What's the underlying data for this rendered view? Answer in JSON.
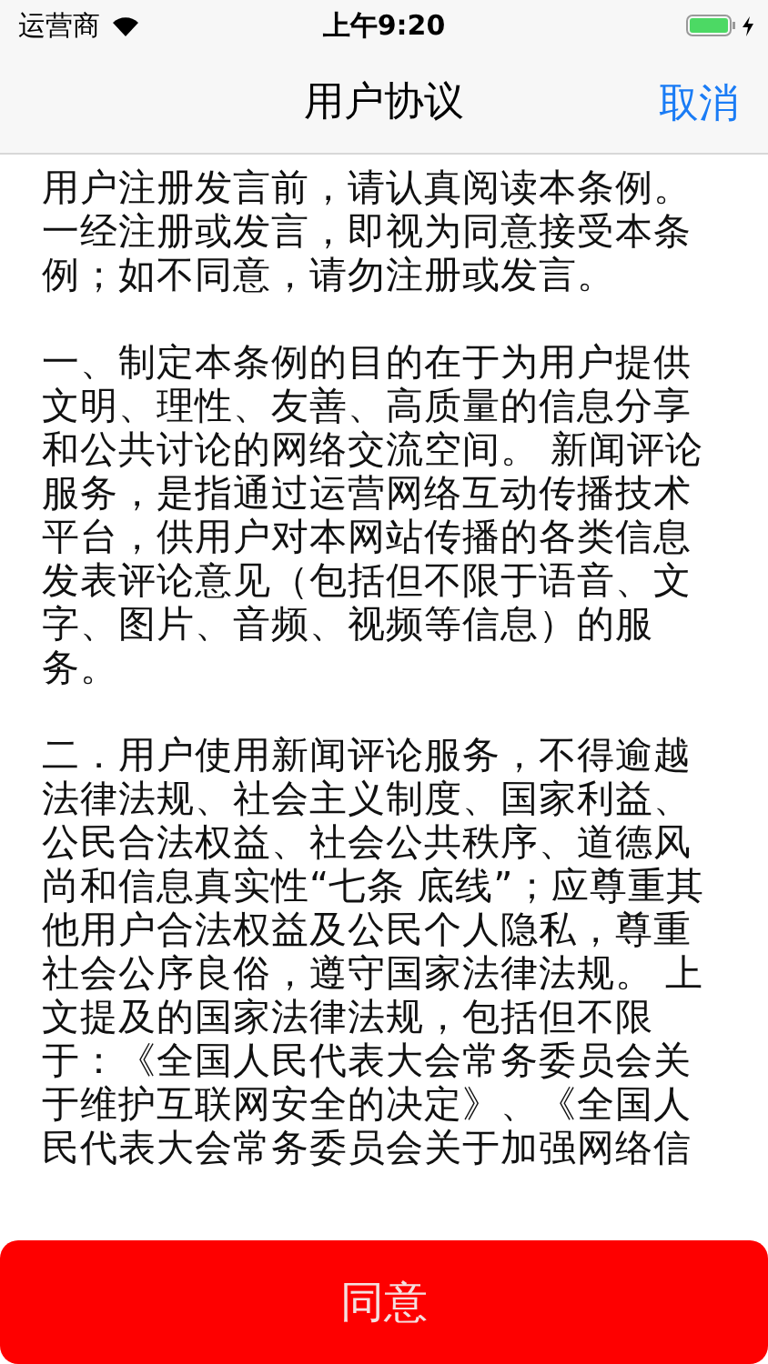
{
  "status_bar": {
    "carrier": "运营商",
    "time": "上午9:20",
    "charging": true
  },
  "nav_bar": {
    "title": "用户协议",
    "cancel": "取消"
  },
  "agreement": {
    "paragraphs": [
      {
        "lines": [
          "用户注册发言前，请认真阅读本条例。",
          "一经注册或发言，即视为同意接受本条",
          "例；如不同意，请勿注册或发言。"
        ]
      },
      {
        "lines": [
          "一、制定本条例的目的在于为用户提供",
          "文明、理性、友善、高质量的信息分享",
          "和公共讨论的网络交流空间。 新闻评论",
          "服务，是指通过运营网络互动传播技术",
          "平台，供用户对本网站传播的各类信息",
          "发表评论意见（包括但不限于语音、文",
          "字、图片、音频、视频等信息）的服",
          "务。"
        ]
      },
      {
        "lines": [
          "二．用户使用新闻评论服务，不得逾越",
          "法律法规、社会主义制度、国家利益、",
          "公民合法权益、社会公共秩序、道德风",
          "尚和信息真实性“七条 底线”；应尊重其",
          "他用户合法权益及公民个人隐私，尊重",
          "社会公序良俗，遵守国家法律法规。 上",
          "文提及的国家法律法规，包括但不限",
          "于：《全国人民代表大会常务委员会关",
          "于维护互联网安全的决定》、《全国人",
          "民代表大会常务委员会关于加强网络信"
        ]
      }
    ]
  },
  "agree_button": "同意"
}
